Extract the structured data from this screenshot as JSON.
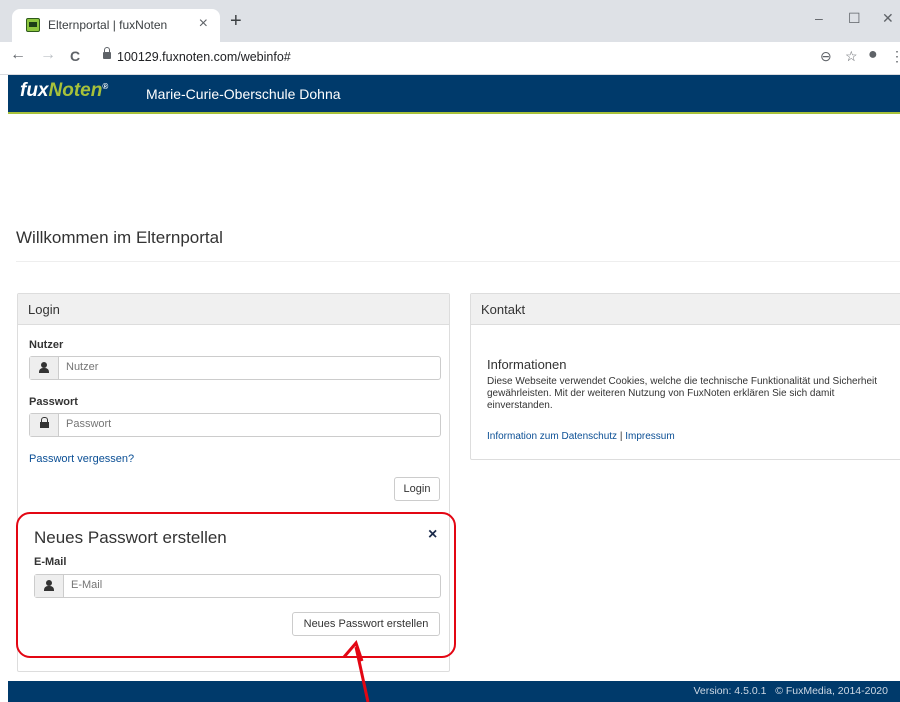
{
  "browser": {
    "tab_title": "Elternportal | fuxNoten",
    "tab_close": "×",
    "new_tab": "+",
    "url": "100129.fuxnoten.com/webinfo#",
    "back": "←",
    "forward": "→",
    "reload": "C",
    "window_minimize": "–",
    "window_maximize": "☐",
    "window_close": "✕",
    "zoom_icon": "⊖",
    "bookmark_icon": "☆",
    "profile_icon": "●",
    "menu_icon": "⋮"
  },
  "header": {
    "logo_fux": "fux",
    "logo_noten": "Noten",
    "logo_reg": "®",
    "school": "Marie-Curie-Oberschule Dohna"
  },
  "welcome": "Willkommen im Elternportal",
  "login": {
    "title": "Login",
    "user_label": "Nutzer",
    "user_placeholder": "Nutzer",
    "password_label": "Passwort",
    "password_placeholder": "Passwort",
    "forgot_link": "Passwort vergessen?",
    "login_button": "Login"
  },
  "reset": {
    "title": "Neues Passwort erstellen",
    "close": "×",
    "email_label": "E-Mail",
    "email_placeholder": "E-Mail",
    "submit_button": "Neues Passwort erstellen"
  },
  "contact": {
    "title": "Kontakt",
    "info_heading": "Informationen",
    "info_text": "Diese Webseite verwendet Cookies, welche die technische Funktionalität und Sicherheit gewährleisten. Mit der weiteren Nutzung von FuxNoten erklären Sie sich damit einverstanden.",
    "privacy_link": "Information zum Datenschutz",
    "separator": "|",
    "imprint_link": "Impressum"
  },
  "footer": {
    "version": "Version: 4.5.0.1",
    "copyright": "© FuxMedia, 2014-2020"
  },
  "colors": {
    "navbar": "#003a6b",
    "accent": "#a7c13a",
    "annotation": "#e30613"
  }
}
